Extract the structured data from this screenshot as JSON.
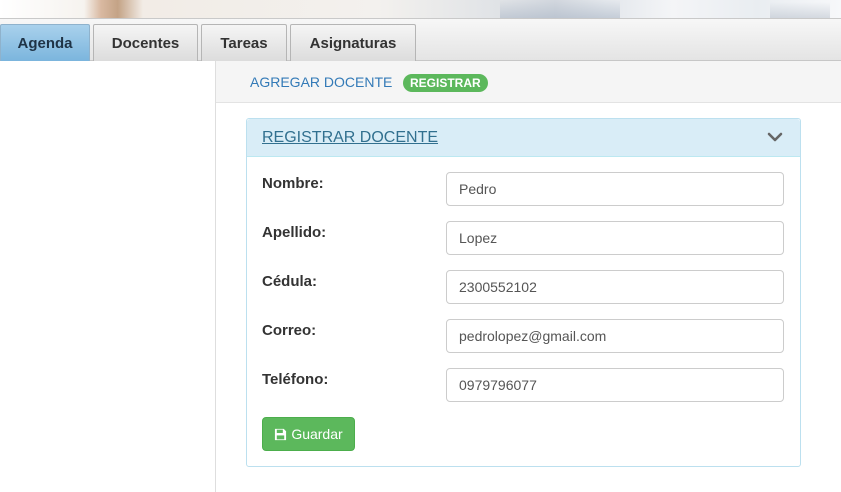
{
  "tabs": [
    {
      "label": "Agenda",
      "active": true
    },
    {
      "label": "Docentes",
      "active": false
    },
    {
      "label": "Tareas",
      "active": false
    },
    {
      "label": "Asignaturas",
      "active": false
    }
  ],
  "subheader": {
    "crumb": "AGREGAR DOCENTE",
    "badge": "REGISTRAR"
  },
  "panel": {
    "title": "REGISTRAR DOCENTE",
    "toggle_icon": "chevron-down-icon"
  },
  "form": {
    "fields": [
      {
        "label": "Nombre:",
        "value": "Pedro"
      },
      {
        "label": "Apellido:",
        "value": "Lopez"
      },
      {
        "label": "Cédula:",
        "value": "2300552102"
      },
      {
        "label": "Correo:",
        "value": "pedrolopez@gmail.com"
      },
      {
        "label": "Teléfono:",
        "value": "0979796077"
      }
    ],
    "save_label": "Guardar",
    "save_icon": "floppy-disk-icon"
  },
  "colors": {
    "accent": "#5cb85c",
    "panel_head": "#d9edf7",
    "link": "#337ab7",
    "active_tab": "#7bb5dd"
  }
}
